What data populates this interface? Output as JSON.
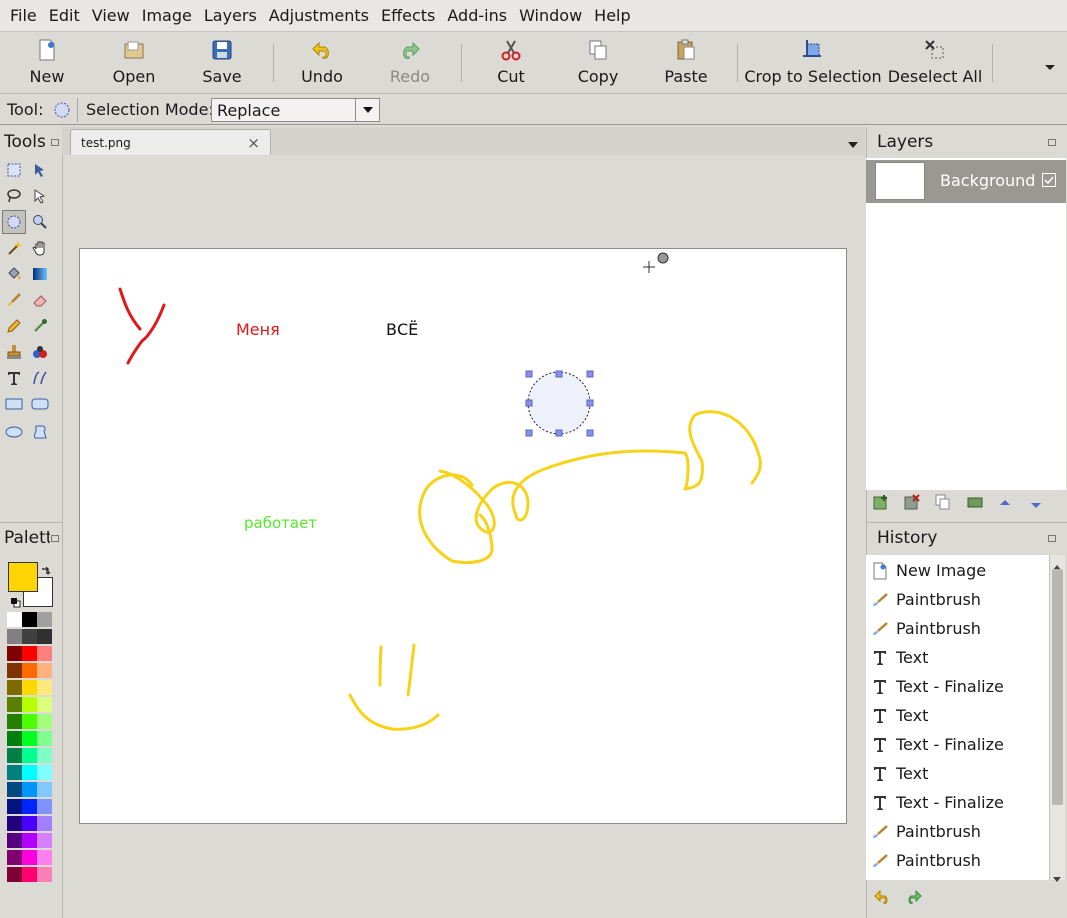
{
  "menu": [
    "File",
    "Edit",
    "View",
    "Image",
    "Layers",
    "Adjustments",
    "Effects",
    "Add-ins",
    "Window",
    "Help"
  ],
  "toolbar": {
    "new": "New",
    "open": "Open",
    "save": "Save",
    "undo": "Undo",
    "redo": "Redo",
    "cut": "Cut",
    "copy": "Copy",
    "paste": "Paste",
    "crop": "Crop to Selection",
    "deselect": "Deselect All"
  },
  "tool_options": {
    "tool_label": "Tool:",
    "mode_label": "Selection Mode:",
    "mode_value": "Replace"
  },
  "tools_panel": {
    "title": "Tools"
  },
  "palette_panel": {
    "title": "Palett",
    "primary": "#ffd400",
    "secondary": "#ffffff"
  },
  "document": {
    "tab_title": "test.png",
    "close": "×"
  },
  "canvas_text": {
    "t1": "Меня",
    "t2": "ВСЁ",
    "t3": "работает"
  },
  "canvas_colors": {
    "red": "#e01818",
    "black": "#111111",
    "green": "#55e82a",
    "yellow": "#f6d318"
  },
  "layers": {
    "title": "Layers",
    "items": [
      {
        "name": "Background",
        "visible": true
      }
    ]
  },
  "history": {
    "title": "History",
    "items": [
      "New Image",
      "Paintbrush",
      "Paintbrush",
      "Text",
      "Text - Finalize",
      "Text",
      "Text - Finalize",
      "Text",
      "Text - Finalize",
      "Paintbrush",
      "Paintbrush"
    ]
  },
  "palette_colors": [
    [
      "#ffffff",
      "#000000",
      "#a0a0a0"
    ],
    [
      "#808080",
      "#404040",
      "#303030"
    ],
    [
      "#7f0000",
      "#ff0000",
      "#ff7f7f"
    ],
    [
      "#7f3300",
      "#ff6a00",
      "#ffb27f"
    ],
    [
      "#7f6a00",
      "#ffd800",
      "#ffe97f"
    ],
    [
      "#5b7f00",
      "#b6ff00",
      "#daff7f"
    ],
    [
      "#267f00",
      "#4cff00",
      "#a5ff7f"
    ],
    [
      "#007f0e",
      "#00ff21",
      "#7fff8e"
    ],
    [
      "#007f46",
      "#00ff90",
      "#7fffc5"
    ],
    [
      "#007f7f",
      "#00ffff",
      "#7fffff"
    ],
    [
      "#004a7f",
      "#0094ff",
      "#7fc9ff"
    ],
    [
      "#00137f",
      "#0026ff",
      "#7f92ff"
    ],
    [
      "#21007f",
      "#4800ff",
      "#a17fff"
    ],
    [
      "#57007f",
      "#b200ff",
      "#d67fff"
    ],
    [
      "#7f006e",
      "#ff00dc",
      "#ff7fed"
    ],
    [
      "#7f0037",
      "#ff006e",
      "#ff7fb6"
    ]
  ]
}
